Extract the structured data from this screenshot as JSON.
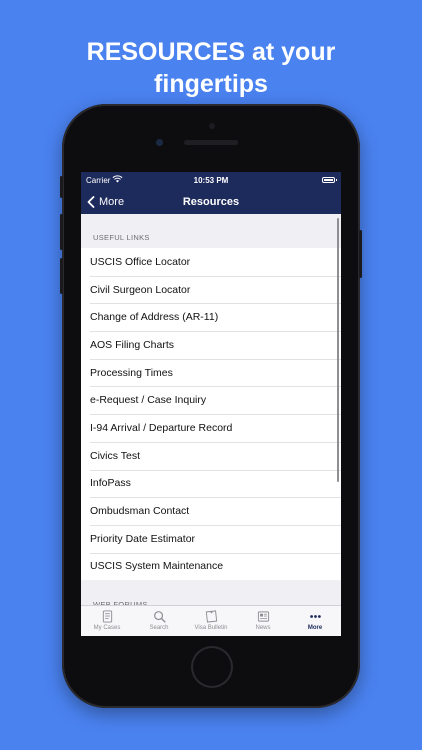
{
  "headline": {
    "line1": "RESOURCES at your",
    "line2": "fingertips"
  },
  "statusbar": {
    "carrier": "Carrier",
    "time": "10:53 PM"
  },
  "navbar": {
    "back_label": "More",
    "title": "Resources"
  },
  "sections": [
    {
      "header": "USEFUL LINKS",
      "items": [
        "USCIS Office Locator",
        "Civil Surgeon Locator",
        "Change of Address (AR-11)",
        "AOS Filing Charts",
        "Processing Times",
        "e-Request / Case Inquiry",
        "I-94 Arrival / Departure Record",
        "Civics Test",
        "InfoPass",
        "Ombudsman Contact",
        "Priority Date Estimator",
        "USCIS System Maintenance"
      ]
    },
    {
      "header": "WEB FORUMS"
    }
  ],
  "tabbar": {
    "active": 4,
    "tabs": [
      {
        "label": "My Cases",
        "icon": "document-icon"
      },
      {
        "label": "Search",
        "icon": "search-icon"
      },
      {
        "label": "Visa Bulletin",
        "icon": "bulletin-icon"
      },
      {
        "label": "News",
        "icon": "newspaper-icon"
      },
      {
        "label": "More",
        "icon": "more-dots-icon"
      }
    ]
  },
  "colors": {
    "background": "#4a82f0",
    "navbar": "#1d2a5c",
    "tab_active": "#1d2a5c",
    "tab_inactive": "#8e8e93"
  }
}
